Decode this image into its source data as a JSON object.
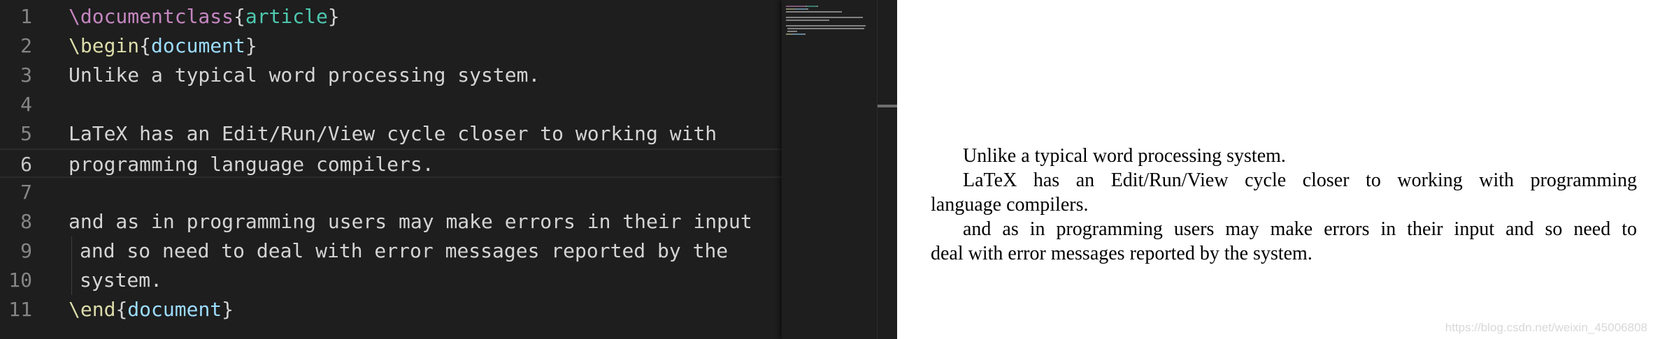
{
  "editor": {
    "lines": [
      {
        "number": "1",
        "segments": [
          {
            "text": "\\documentclass",
            "color": "#c586c0"
          },
          {
            "text": "{",
            "color": "#d4d4d4"
          },
          {
            "text": "article",
            "color": "#4ec9b0"
          },
          {
            "text": "}",
            "color": "#d4d4d4"
          }
        ]
      },
      {
        "number": "2",
        "segments": [
          {
            "text": "\\begin",
            "color": "#dcdcaa"
          },
          {
            "text": "{",
            "color": "#d4d4d4"
          },
          {
            "text": "document",
            "color": "#9cdcfe"
          },
          {
            "text": "}",
            "color": "#d4d4d4"
          }
        ]
      },
      {
        "number": "3",
        "segments": [
          {
            "text": "Unlike a typical word processing system.",
            "color": "#d4d4d4"
          }
        ]
      },
      {
        "number": "4",
        "segments": []
      },
      {
        "number": "5",
        "segments": [
          {
            "text": "LaTeX has an Edit/Run/View cycle closer to working with",
            "color": "#d4d4d4"
          }
        ]
      },
      {
        "number": "6",
        "segments": [
          {
            "text": "programming language compilers.",
            "color": "#d4d4d4"
          }
        ],
        "current": true
      },
      {
        "number": "7",
        "segments": []
      },
      {
        "number": "8",
        "segments": [
          {
            "text": "and as in programming users may make errors in their input",
            "color": "#d4d4d4"
          }
        ]
      },
      {
        "number": "9",
        "segments": [
          {
            "text": "and so need to deal with error messages reported by the",
            "color": "#d4d4d4"
          }
        ],
        "indented": true
      },
      {
        "number": "10",
        "segments": [
          {
            "text": "system.",
            "color": "#d4d4d4"
          }
        ],
        "indented": true
      },
      {
        "number": "11",
        "segments": [
          {
            "text": "\\end",
            "color": "#dcdcaa"
          },
          {
            "text": "{",
            "color": "#d4d4d4"
          },
          {
            "text": "document",
            "color": "#9cdcfe"
          },
          {
            "text": "}",
            "color": "#d4d4d4"
          }
        ]
      }
    ]
  },
  "preview": {
    "paragraph1": "Unlike a typical word processing system.",
    "paragraph2_line1": "LaTeX has an Edit/Run/View cycle closer to working with programming",
    "paragraph2_line2": "language compilers.",
    "paragraph3_line1": "and as in programming users may make errors in their input and so need to",
    "paragraph3_line2": "deal with error messages reported by the system.",
    "watermark": "https://blog.csdn.net/weixin_45006808"
  }
}
